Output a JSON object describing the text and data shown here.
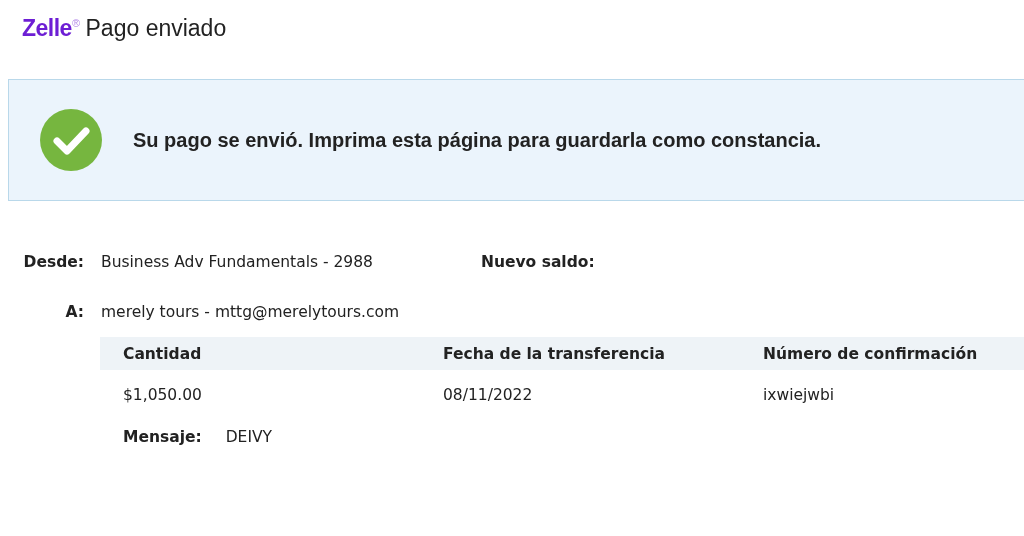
{
  "header": {
    "logo": "Zelle",
    "logo_mark": "®",
    "title": "Pago enviado"
  },
  "notice": {
    "kind": "success",
    "text": "Su pago se envió. Imprima esta página para guardarla como constancia."
  },
  "details": {
    "from_label": "Desde:",
    "from_value": "Business Adv Fundamentals - 2988",
    "balance_label": "Nuevo saldo:",
    "to_label": "A:",
    "to_value": "merely tours - mttg@merelytours.com"
  },
  "table": {
    "columns": [
      "Cantidad",
      "Fecha de la transferencia",
      "Número de confirmación"
    ],
    "rows": [
      [
        "$1,050.00",
        "08/11/2022",
        "ixwiejwbi"
      ]
    ]
  },
  "message": {
    "label": "Mensaje:",
    "value": "DEIVY"
  }
}
